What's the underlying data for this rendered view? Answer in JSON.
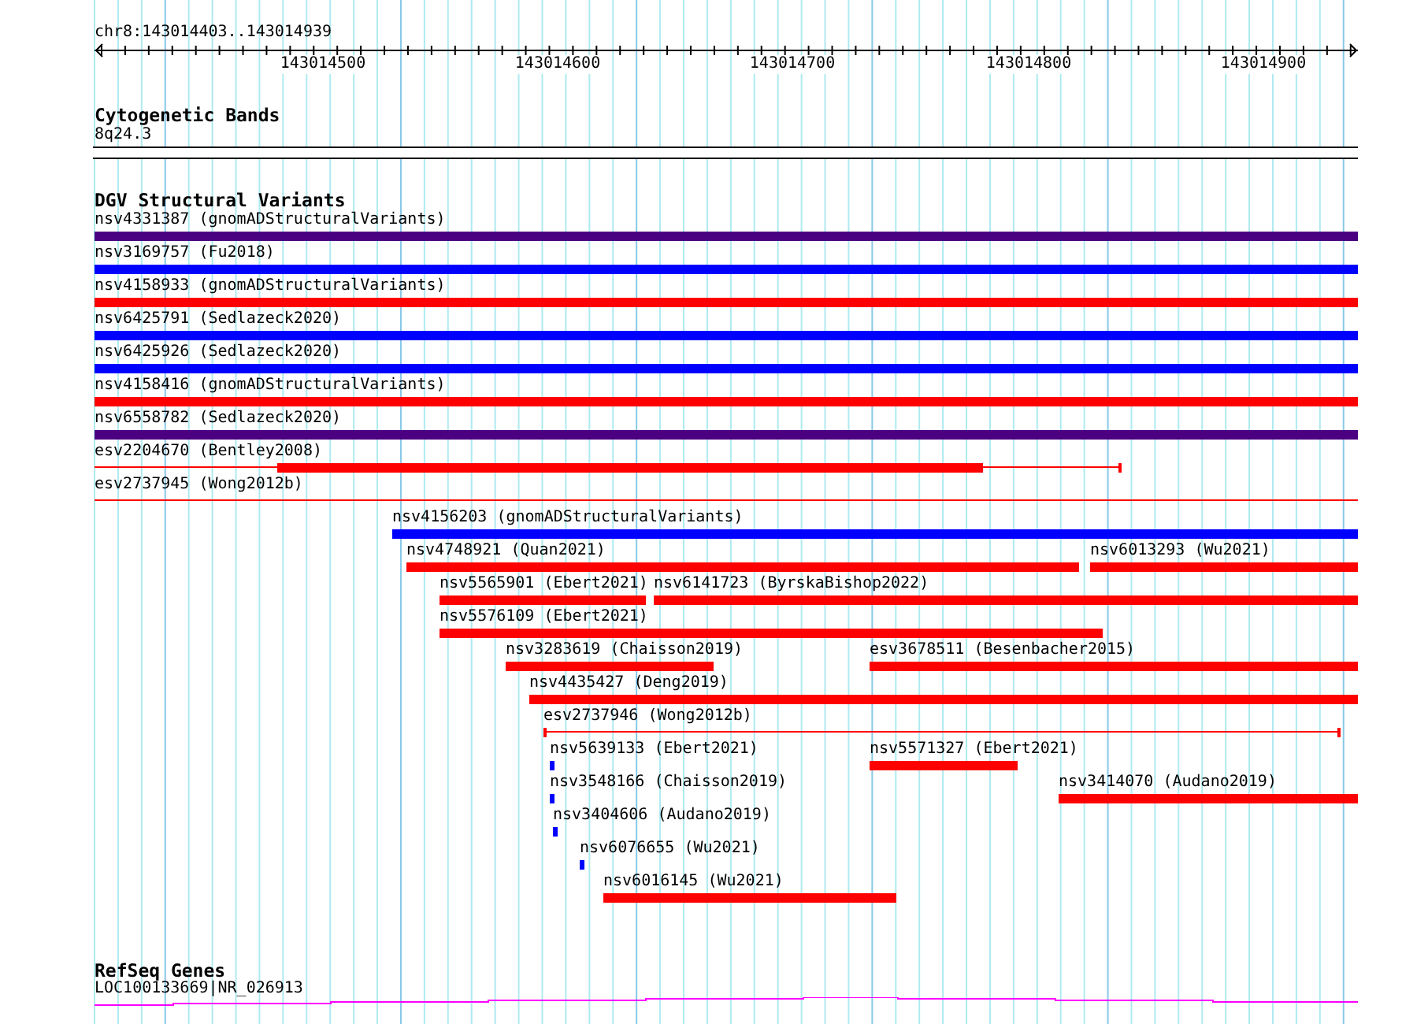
{
  "ruler": {
    "location": "chr8:143014403..143014939",
    "ticks": [
      "143014500",
      "143014600",
      "143014700",
      "143014800",
      "143014900"
    ]
  },
  "cytogenetic_bands": {
    "title": "Cytogenetic Bands",
    "band": "8q24.3"
  },
  "dgv": {
    "title": "DGV Structural Variants",
    "rows": [
      [
        {
          "label": "nsv4331387 (gnomADStructuralVariants)",
          "kind": "bar",
          "color": "#4b0082"
        }
      ],
      [
        {
          "label": "nsv3169757 (Fu2018)",
          "kind": "bar",
          "color": "#0000ff"
        }
      ],
      [
        {
          "label": "nsv4158933 (gnomADStructuralVariants)",
          "kind": "bar",
          "color": "#ff0000"
        }
      ],
      [
        {
          "label": "nsv6425791 (Sedlazeck2020)",
          "kind": "bar",
          "color": "#0000ff"
        }
      ],
      [
        {
          "label": "nsv6425926 (Sedlazeck2020)",
          "kind": "bar",
          "color": "#0000ff"
        }
      ],
      [
        {
          "label": "nsv4158416 (gnomADStructuralVariants)",
          "kind": "bar",
          "color": "#ff0000"
        }
      ],
      [
        {
          "label": "nsv6558782 (Sedlazeck2020)",
          "kind": "bar",
          "color": "#4b0082"
        }
      ],
      [
        {
          "label": "esv2204670 (Bentley2008)",
          "kind": "line_block",
          "color": "#ff0000"
        }
      ],
      [
        {
          "label": "esv2737945 (Wong2012b)",
          "kind": "line",
          "color": "#ff0000"
        }
      ],
      [
        {
          "label": "nsv4156203 (gnomADStructuralVariants)",
          "kind": "bar",
          "color": "#0000ff"
        }
      ],
      [
        {
          "label": "nsv4748921 (Quan2021)",
          "kind": "bar",
          "color": "#ff0000"
        },
        {
          "label": "nsv6013293 (Wu2021)",
          "kind": "bar",
          "color": "#ff0000"
        }
      ],
      [
        {
          "label": "nsv5565901 (Ebert2021)",
          "kind": "bar",
          "color": "#ff0000"
        },
        {
          "label": "nsv6141723 (ByrskaBishop2022)",
          "kind": "bar",
          "color": "#ff0000"
        }
      ],
      [
        {
          "label": "nsv5576109 (Ebert2021)",
          "kind": "bar",
          "color": "#ff0000"
        }
      ],
      [
        {
          "label": "nsv3283619 (Chaisson2019)",
          "kind": "bar",
          "color": "#ff0000"
        },
        {
          "label": "esv3678511 (Besenbacher2015)",
          "kind": "bar",
          "color": "#ff0000"
        }
      ],
      [
        {
          "label": "nsv4435427 (Deng2019)",
          "kind": "bar",
          "color": "#ff0000"
        }
      ],
      [
        {
          "label": "esv2737946 (Wong2012b)",
          "kind": "line",
          "color": "#ff0000"
        }
      ],
      [
        {
          "label": "nsv5639133 (Ebert2021)",
          "kind": "bar",
          "color": "#0000ff"
        },
        {
          "label": "nsv5571327 (Ebert2021)",
          "kind": "bar",
          "color": "#ff0000"
        }
      ],
      [
        {
          "label": "nsv3548166 (Chaisson2019)",
          "kind": "bar",
          "color": "#0000ff"
        },
        {
          "label": "nsv3414070 (Audano2019)",
          "kind": "bar",
          "color": "#ff0000"
        }
      ],
      [
        {
          "label": "nsv3404606 (Audano2019)",
          "kind": "bar",
          "color": "#0000ff"
        }
      ],
      [
        {
          "label": "nsv6076655 (Wu2021)",
          "kind": "bar",
          "color": "#0000ff"
        }
      ],
      [
        {
          "label": "nsv6016145 (Wu2021)",
          "kind": "bar",
          "color": "#ff0000"
        }
      ]
    ]
  },
  "refseq_genes": {
    "title": "RefSeq Genes",
    "gene": "LOC100133669|NR_026913"
  }
}
